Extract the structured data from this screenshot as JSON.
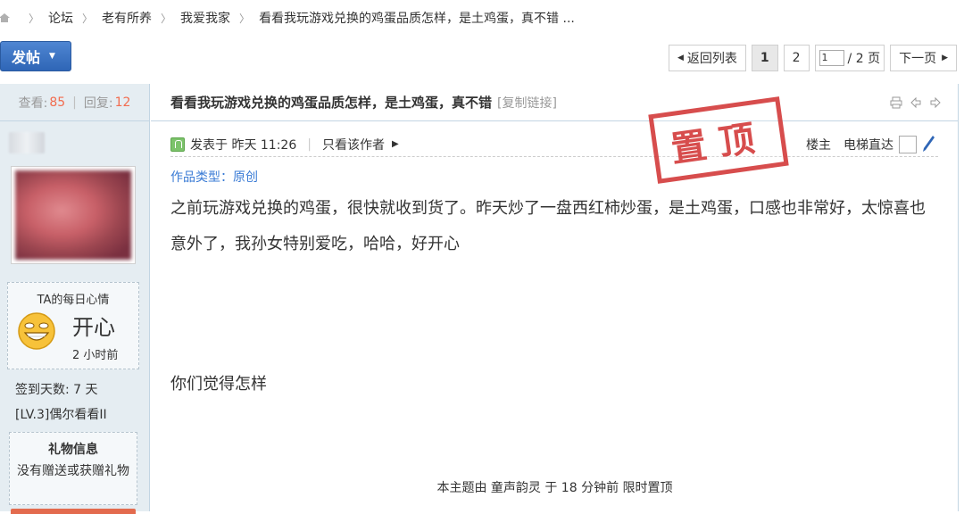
{
  "breadcrumb": {
    "items": [
      "论坛",
      "老有所养",
      "我爱我家",
      "看看我玩游戏兑换的鸡蛋品质怎样，是土鸡蛋，真不错 ..."
    ]
  },
  "toolbar": {
    "post_label": "发帖"
  },
  "pager": {
    "back_label": "返回列表",
    "pages": [
      "1",
      "2"
    ],
    "current_page": "1",
    "input_value": "1",
    "total_label": "/ 2 页",
    "next_label": "下一页"
  },
  "sidebar": {
    "views_label": "查看:",
    "views": "85",
    "replies_label": "回复:",
    "replies": "12",
    "mood_title": "TA的每日心情",
    "mood_word": "开心",
    "mood_time": "2 小时前",
    "sign_days": "签到天数: 7 天",
    "level": "[LV.3]偶尔看看II",
    "gift_title": "礼物信息",
    "gift_text": "没有赠送或获赠礼物"
  },
  "post": {
    "title": "看看我玩游戏兑换的鸡蛋品质怎样，是土鸡蛋，真不错",
    "copy_link": "[复制链接]",
    "posted_at": "发表于 昨天 11:26",
    "only_author": "只看该作者",
    "floor": "楼主",
    "elevator": "电梯直达",
    "stamp": "置顶",
    "work_type": "作品类型：原创",
    "body": "之前玩游戏兑换的鸡蛋，很快就收到货了。昨天炒了一盘西红柿炒蛋，是土鸡蛋，口感也非常好，太惊喜也意外了，我孙女特别爱吃，哈哈，好开心",
    "body2": "你们觉得怎样",
    "pin_note": "本主题由 童声韵灵 于 18 分钟前 限时置顶"
  },
  "colors": {
    "accent": "#2f66b6",
    "count_red": "#f26c4f",
    "stamp_red": "#d33a3a",
    "link_blue": "#3a7bd5",
    "sidebar_bg": "#e5edf2"
  }
}
